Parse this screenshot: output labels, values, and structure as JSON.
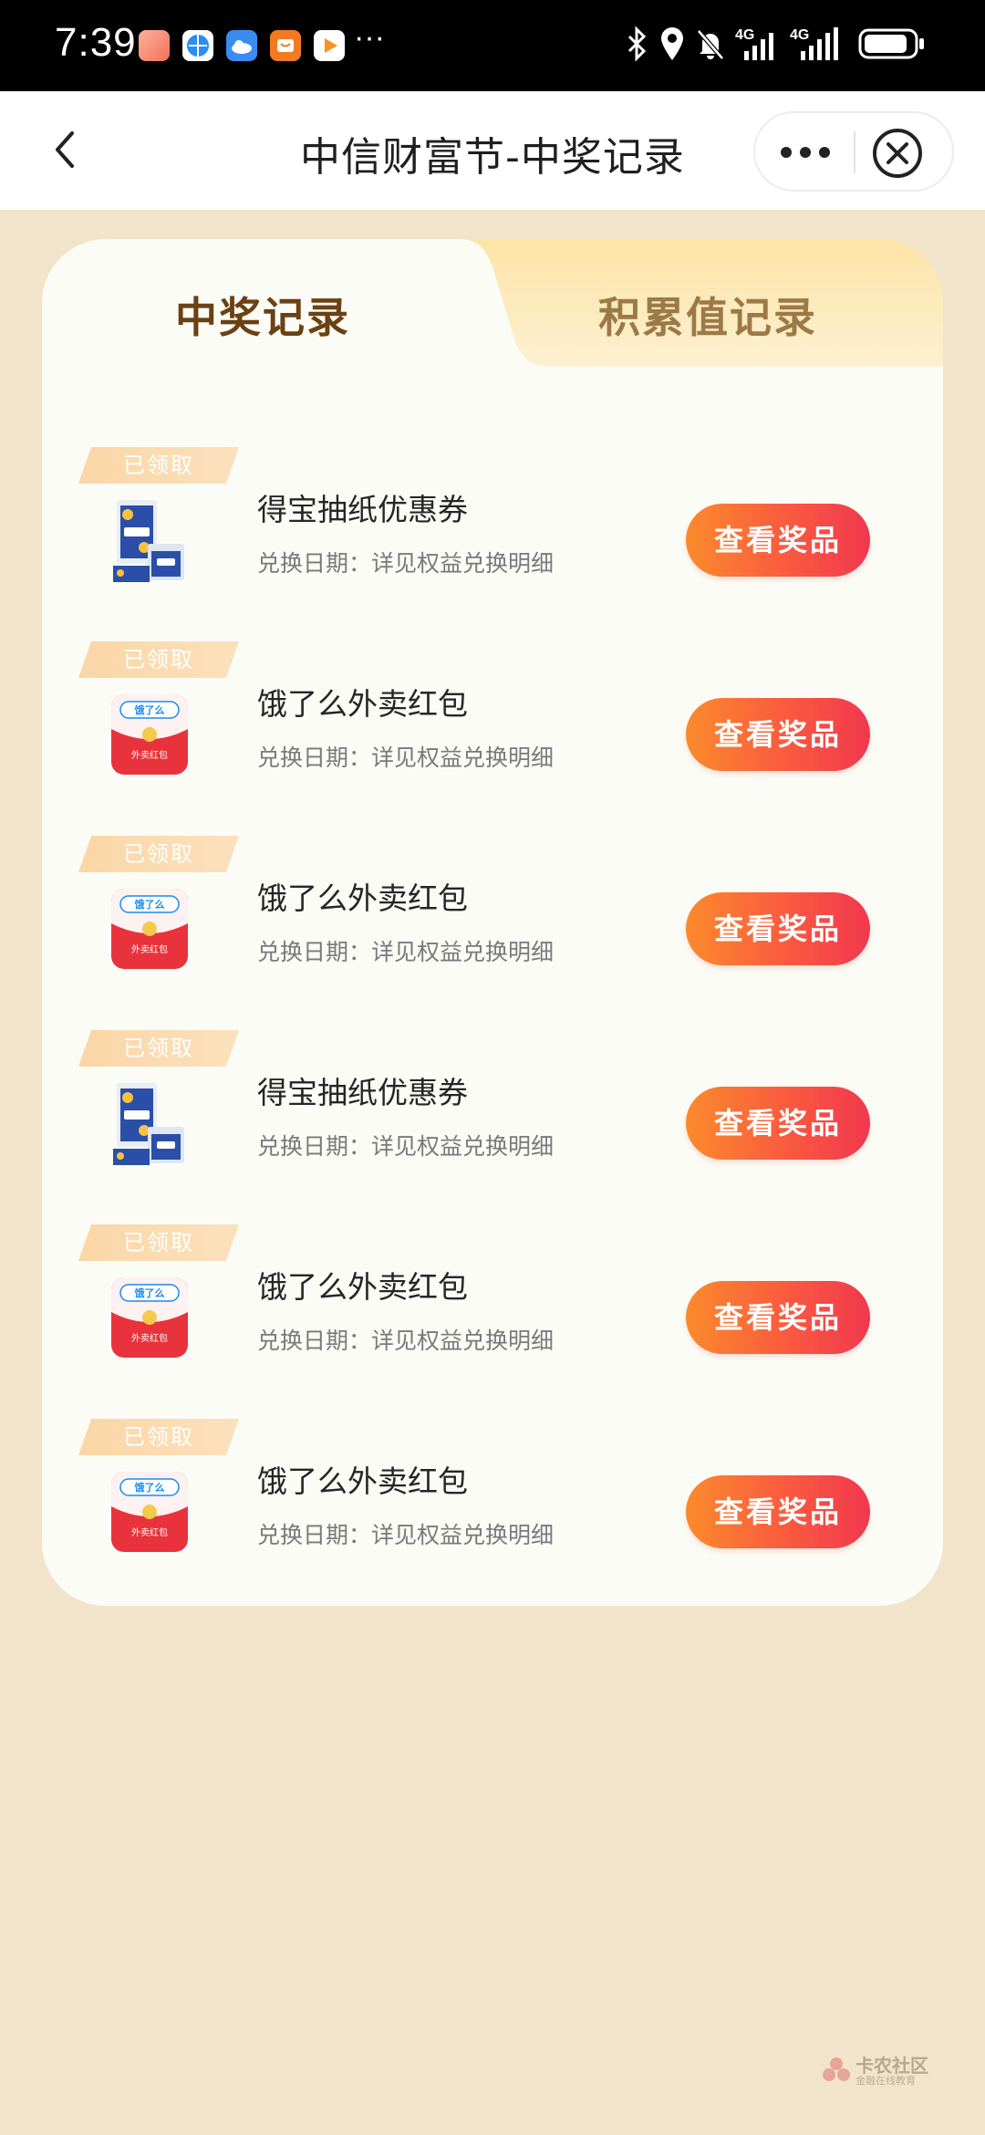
{
  "status_bar": {
    "time": "7:39",
    "dots": "···",
    "network_1": "4G",
    "network_2": "4G",
    "icons": [
      "bluetooth-icon",
      "location-icon",
      "mute-icon",
      "signal-icon",
      "battery-icon"
    ]
  },
  "header": {
    "title": "中信财富节-中奖记录",
    "back_icon": "chevron-left-icon",
    "more_icon": "more-icon",
    "close_icon": "close-icon"
  },
  "tabs": [
    {
      "label": "中奖记录",
      "active": true
    },
    {
      "label": "积累值记录",
      "active": false
    }
  ],
  "prizes": [
    {
      "badge": "已领取",
      "name": "得宝抽纸优惠券",
      "date": "兑换日期：详见权益兑换明细",
      "button": "查看奖品",
      "icon": "tissue-box-icon"
    },
    {
      "badge": "已领取",
      "name": "饿了么外卖红包",
      "date": "兑换日期：详见权益兑换明细",
      "button": "查看奖品",
      "icon": "red-envelope-icon"
    },
    {
      "badge": "已领取",
      "name": "饿了么外卖红包",
      "date": "兑换日期：详见权益兑换明细",
      "button": "查看奖品",
      "icon": "red-envelope-icon"
    },
    {
      "badge": "已领取",
      "name": "得宝抽纸优惠券",
      "date": "兑换日期：详见权益兑换明细",
      "button": "查看奖品",
      "icon": "tissue-box-icon"
    },
    {
      "badge": "已领取",
      "name": "饿了么外卖红包",
      "date": "兑换日期：详见权益兑换明细",
      "button": "查看奖品",
      "icon": "red-envelope-icon"
    },
    {
      "badge": "已领取",
      "name": "饿了么外卖红包",
      "date": "兑换日期：详见权益兑换明细",
      "button": "查看奖品",
      "icon": "red-envelope-icon"
    }
  ],
  "envelope_logo_text": "饿了么",
  "envelope_label": "外卖红包",
  "tissue_brand": "Tempo",
  "watermark": {
    "title": "卡农社区",
    "subtitle": "金融在线教育"
  },
  "colors": {
    "background": "#f2e4ca",
    "card": "#fbfcf6",
    "button_start": "#fb8a2c",
    "button_end": "#f1384f",
    "tab_active_text": "#6b4113",
    "tab_inactive_text": "#9c7a47"
  }
}
